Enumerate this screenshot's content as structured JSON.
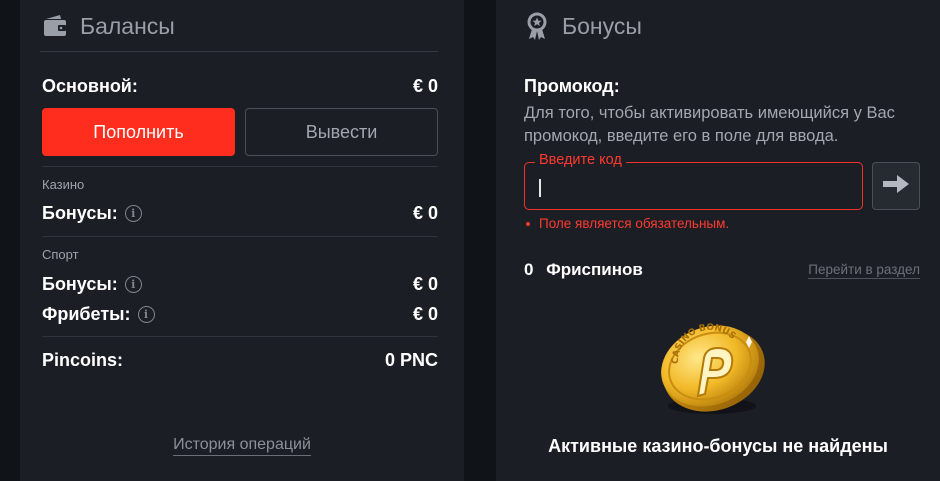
{
  "balances": {
    "title": "Балансы",
    "icon": "wallet-icon",
    "main": {
      "label": "Основной:",
      "value": "€ 0"
    },
    "deposit_button": "Пополнить",
    "withdraw_button": "Вывести",
    "casino": {
      "section": "Казино",
      "bonuses": {
        "label": "Бонусы:",
        "value": "€ 0"
      }
    },
    "sport": {
      "section": "Спорт",
      "bonuses": {
        "label": "Бонусы:",
        "value": "€ 0"
      },
      "freebets": {
        "label": "Фрибеты:",
        "value": "€ 0"
      }
    },
    "pincoins": {
      "label": "Pincoins:",
      "value": "0 PNC"
    },
    "history_link": "История операций"
  },
  "bonuses": {
    "title": "Бонусы",
    "icon": "award-medal-icon",
    "promo": {
      "title": "Промокод:",
      "description": "Для того, чтобы активировать имеющийся у Вас промокод, введите его в поле для ввода.",
      "input_label": "Введите код",
      "input_value": "",
      "error": "Поле является обязательным."
    },
    "freespins": {
      "count": "0",
      "label": "Фриспинов",
      "link": "Перейти в раздел"
    },
    "coin_text": "CASINO BONUS",
    "empty_message": "Активные казино-бонусы не найдены"
  },
  "colors": {
    "background": "#101318",
    "panel": "#1b1e25",
    "accent": "#ff2d1d",
    "error": "#ff3a2e",
    "muted_text": "#9a9ea6"
  }
}
